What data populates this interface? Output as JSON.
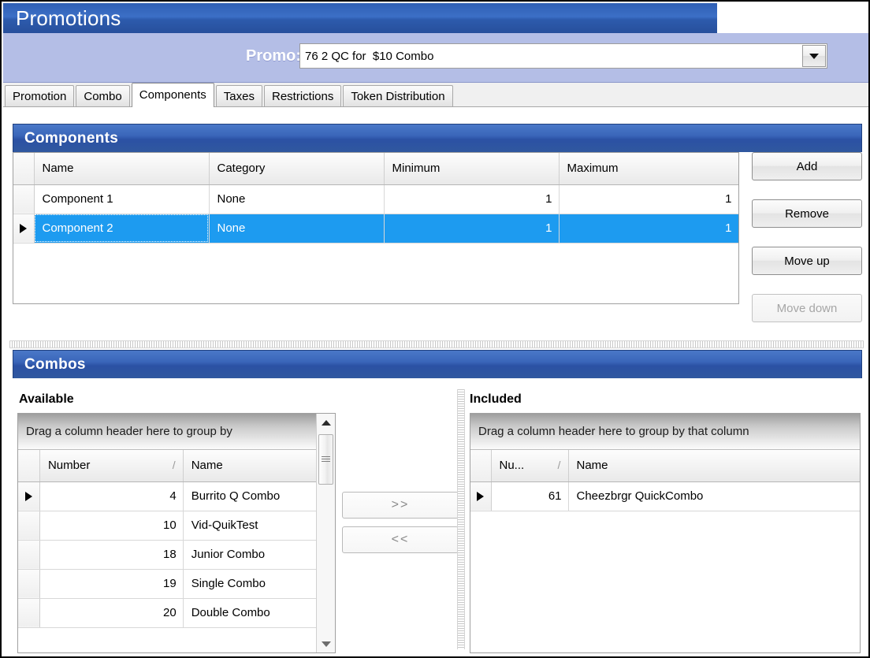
{
  "window": {
    "title": "Promotions"
  },
  "promo": {
    "label": "Promo:",
    "value": "76 2 QC for  $10 Combo",
    "dropdown_icon": "chevron-down-icon"
  },
  "tabs": [
    {
      "label": "Promotion",
      "active": false
    },
    {
      "label": "Combo",
      "active": false
    },
    {
      "label": "Components",
      "active": true
    },
    {
      "label": "Taxes",
      "active": false
    },
    {
      "label": "Restrictions",
      "active": false
    },
    {
      "label": "Token Distribution",
      "active": false
    }
  ],
  "components": {
    "title": "Components",
    "columns": [
      "Name",
      "Category",
      "Minimum",
      "Maximum"
    ],
    "rows": [
      {
        "indicator": "",
        "name": "Component 1",
        "category": "None",
        "minimum": "1",
        "maximum": "1",
        "selected": false
      },
      {
        "indicator": "row-arrow",
        "name": "Component 2",
        "category": "None",
        "minimum": "1",
        "maximum": "1",
        "selected": true
      }
    ],
    "buttons": [
      {
        "label": "Add",
        "enabled": true
      },
      {
        "label": "Remove",
        "enabled": true
      },
      {
        "label": "Move up",
        "enabled": true
      },
      {
        "label": "Move down",
        "enabled": false
      }
    ]
  },
  "combos": {
    "title": "Combos",
    "available": {
      "label": "Available",
      "group_hint": "Drag a column header here to group by",
      "columns": [
        "Number",
        "Name"
      ],
      "sort_glyph": "/",
      "rows": [
        {
          "indicator": "row-arrow",
          "number": "4",
          "name": "Burrito Q Combo"
        },
        {
          "indicator": "",
          "number": "10",
          "name": "Vid-QuikTest"
        },
        {
          "indicator": "",
          "number": "18",
          "name": "Junior Combo"
        },
        {
          "indicator": "",
          "number": "19",
          "name": "Single Combo"
        },
        {
          "indicator": "",
          "number": "20",
          "name": "Double Combo"
        }
      ]
    },
    "included": {
      "label": "Included",
      "group_hint": "Drag a column header here to group by that column",
      "columns": [
        "Nu...",
        "Name"
      ],
      "sort_glyph": "/",
      "rows": [
        {
          "indicator": "row-arrow",
          "number": "61",
          "name": "Cheezbrgr QuickCombo"
        }
      ]
    },
    "transfer_buttons": [
      {
        "label": ">>",
        "name": "move-right-button"
      },
      {
        "label": "<<",
        "name": "move-left-button"
      }
    ]
  },
  "colors": {
    "title_bar": "#2f5fb4",
    "promo_bar": "#b4bee6",
    "panel_header": "#3a66ba",
    "selection": "#1d9bf0"
  }
}
